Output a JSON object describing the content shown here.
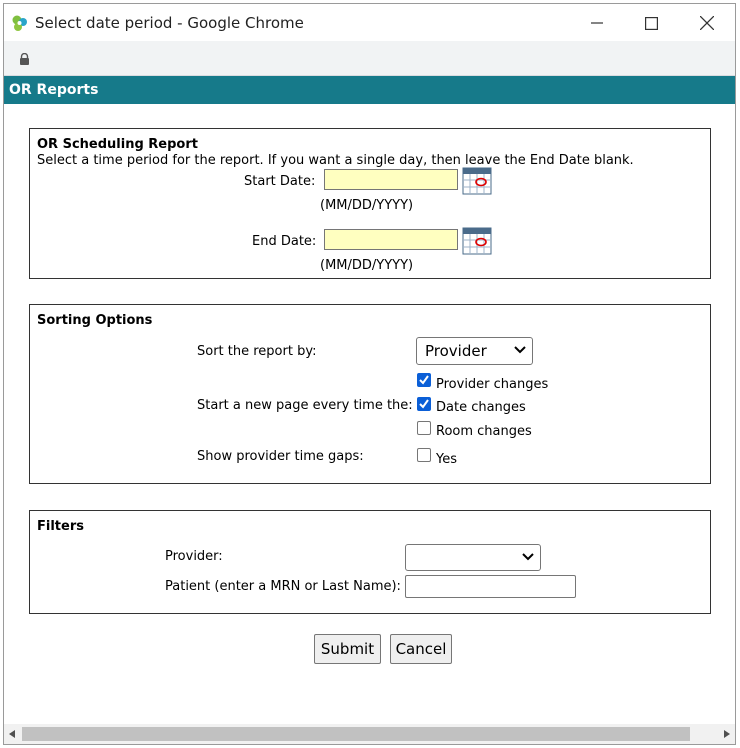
{
  "window": {
    "title": "Select date period - Google Chrome"
  },
  "header": {
    "title": "OR Reports"
  },
  "scheduling": {
    "title": "OR Scheduling Report",
    "description": "Select a time period for the report. If you want a single day, then leave the End Date blank.",
    "start_label": "Start Date:",
    "start_value": "",
    "start_hint": "(MM/DD/YYYY)",
    "end_label": "End Date:",
    "end_value": "",
    "end_hint": "(MM/DD/YYYY)"
  },
  "sorting": {
    "title": "Sorting Options",
    "sort_label": "Sort the report by:",
    "sort_value": "Provider",
    "newpage_label": "Start a new page every time the:",
    "options": [
      {
        "label": "Provider changes",
        "checked": true
      },
      {
        "label": "Date changes",
        "checked": true
      },
      {
        "label": "Room changes",
        "checked": false
      }
    ],
    "gaps_label": "Show provider time gaps:",
    "gaps_option": {
      "label": "Yes",
      "checked": false
    }
  },
  "filters": {
    "title": "Filters",
    "provider_label": "Provider:",
    "provider_value": "",
    "patient_label": "Patient (enter a MRN or Last Name):",
    "patient_value": ""
  },
  "actions": {
    "submit_label": "Submit",
    "cancel_label": "Cancel"
  },
  "colors": {
    "header_bg": "#167a8a",
    "date_input_bg": "#ffffc0",
    "checkbox_checked": "#0b5fd7"
  }
}
